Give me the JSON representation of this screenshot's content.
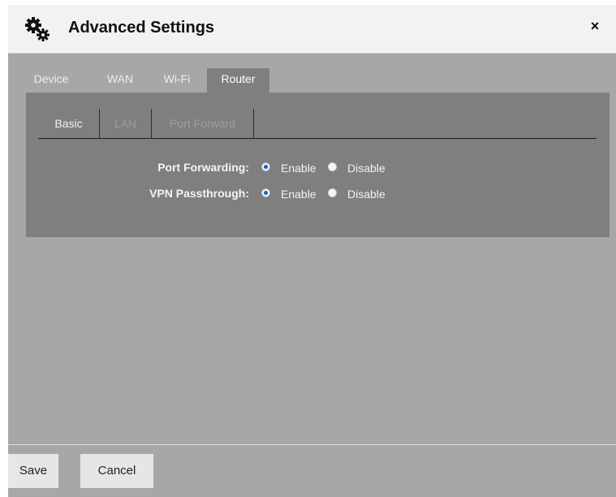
{
  "dialog": {
    "title": "Advanced Settings",
    "title_icon": "gears-icon",
    "close_label": "×"
  },
  "tabs": [
    {
      "label": "Device",
      "active": false
    },
    {
      "label": "WAN",
      "active": false
    },
    {
      "label": "Wi-Fi",
      "active": false
    },
    {
      "label": "Router",
      "active": true
    }
  ],
  "subtabs": [
    {
      "label": "Basic",
      "active": true
    },
    {
      "label": "LAN",
      "active": false
    },
    {
      "label": "Port Forward",
      "active": false
    }
  ],
  "form": {
    "port_forwarding": {
      "label": "Port Forwarding:",
      "enable_label": "Enable",
      "disable_label": "Disable",
      "selected": "Enable"
    },
    "vpn_passthrough": {
      "label": "VPN Passthrough:",
      "enable_label": "Enable",
      "disable_label": "Disable",
      "selected": "Enable"
    }
  },
  "footer": {
    "save_label": "Save",
    "cancel_label": "Cancel"
  },
  "colors": {
    "selected_radio": "#1f5fb3",
    "panel": "#7f7f7f",
    "dialog_bg": "#a7a7a7"
  }
}
